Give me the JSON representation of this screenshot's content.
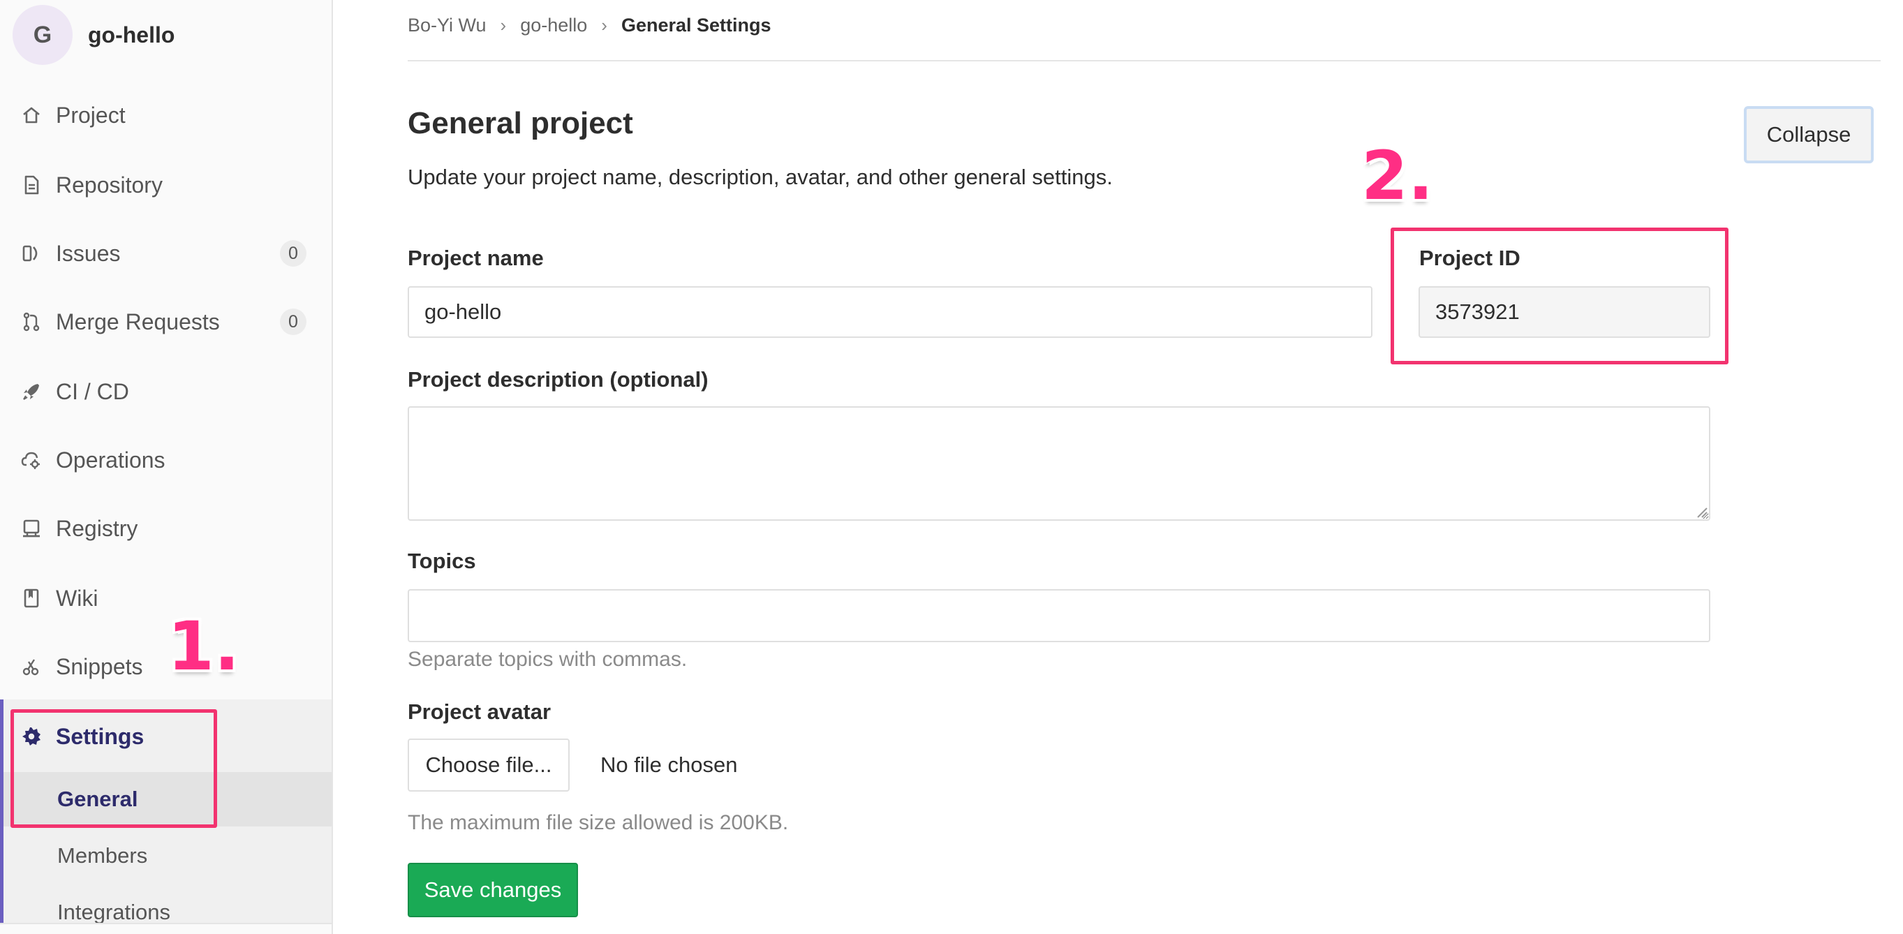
{
  "project": {
    "avatar_letter": "G",
    "name": "go-hello"
  },
  "sidebar": {
    "items": [
      {
        "label": "Project",
        "icon": "home-icon"
      },
      {
        "label": "Repository",
        "icon": "document-icon"
      },
      {
        "label": "Issues",
        "icon": "issues-icon",
        "count": "0"
      },
      {
        "label": "Merge Requests",
        "icon": "merge-request-icon",
        "count": "0"
      },
      {
        "label": "CI / CD",
        "icon": "rocket-icon"
      },
      {
        "label": "Operations",
        "icon": "cloud-gear-icon"
      },
      {
        "label": "Registry",
        "icon": "container-icon"
      },
      {
        "label": "Wiki",
        "icon": "book-icon"
      },
      {
        "label": "Snippets",
        "icon": "scissors-icon"
      },
      {
        "label": "Settings",
        "icon": "gear-icon"
      }
    ],
    "settings_subitems": [
      {
        "label": "General"
      },
      {
        "label": "Members"
      },
      {
        "label": "Integrations"
      }
    ]
  },
  "breadcrumb": [
    "Bo-Yi Wu",
    "go-hello",
    "General Settings"
  ],
  "section": {
    "title": "General project",
    "description": "Update your project name, description, avatar, and other general settings.",
    "collapse_label": "Collapse"
  },
  "form": {
    "project_name_label": "Project name",
    "project_name_value": "go-hello",
    "project_id_label": "Project ID",
    "project_id_value": "3573921",
    "description_label": "Project description (optional)",
    "description_value": "",
    "topics_label": "Topics",
    "topics_value": "",
    "topics_help": "Separate topics with commas.",
    "avatar_label": "Project avatar",
    "choose_file_label": "Choose file...",
    "file_status": "No file chosen",
    "avatar_help": "The maximum file size allowed is 200KB.",
    "save_label": "Save changes"
  },
  "annotations": [
    "1.",
    "2."
  ],
  "colors": {
    "annotation": "#f2336f",
    "save_button": "#1aaa55",
    "settings_active": "#2d2b6b",
    "sidebar_accent": "#6b5fc0"
  }
}
